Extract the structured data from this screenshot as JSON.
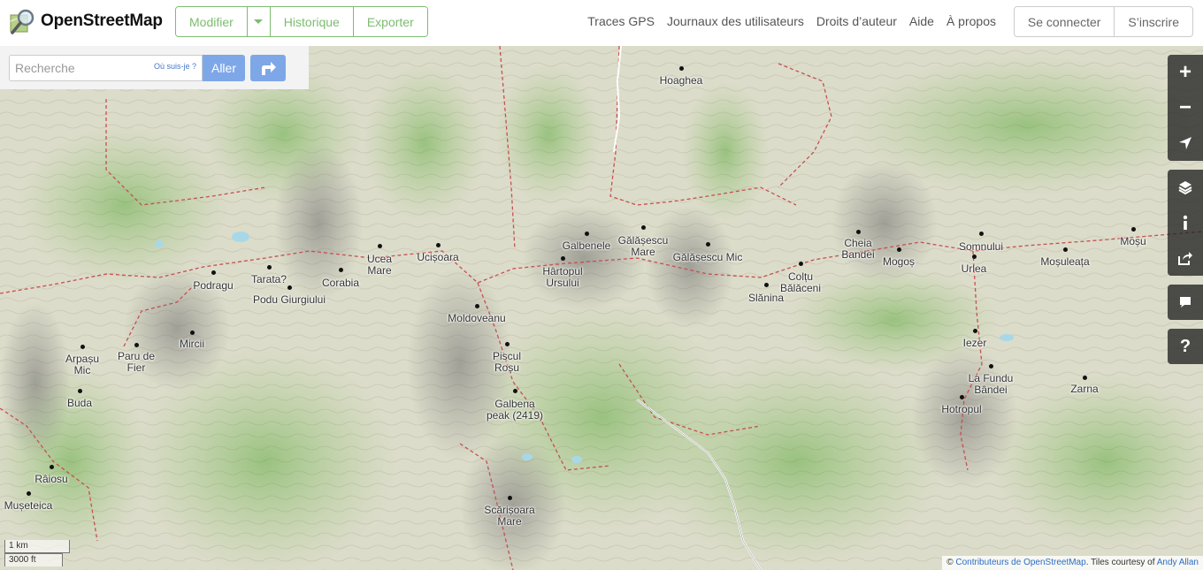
{
  "header": {
    "logo_text": "OpenStreetMap",
    "edit_buttons": [
      "Modifier",
      "Historique",
      "Exporter"
    ],
    "nav_links": [
      "Traces GPS",
      "Journaux des utilisateurs",
      "Droits d’auteur",
      "Aide",
      "À propos"
    ],
    "login_label": "Se connecter",
    "signup_label": "S’inscrire"
  },
  "search": {
    "placeholder": "Recherche",
    "where_am_i": "Où suis-je ?",
    "go_label": "Aller"
  },
  "controls": {
    "zoom_in": "+",
    "zoom_out": "−",
    "help": "?"
  },
  "scale": {
    "metric": "1 km",
    "imperial": "3000 ft"
  },
  "attribution": {
    "prefix": "© ",
    "osm_link": "Contributeurs de OpenStreetMap",
    "middle": ". Tiles courtesy of ",
    "tiles_link": "Andy Allan"
  },
  "places": [
    {
      "name": "Hoaghea"
    },
    {
      "name": "Galbenele"
    },
    {
      "name": "Gălășescu Mare"
    },
    {
      "name": "Gălășescu Mic"
    },
    {
      "name": "Hârtopul Ursului"
    },
    {
      "name": "Ucea Mare"
    },
    {
      "name": "Ucișoara"
    },
    {
      "name": "Corabia"
    },
    {
      "name": "Podragu"
    },
    {
      "name": "Tarata?"
    },
    {
      "name": "Podu Giurgiului"
    },
    {
      "name": "Moldoveanu"
    },
    {
      "name": "Mircii"
    },
    {
      "name": "Paru de Fier"
    },
    {
      "name": "Arpașu Mic"
    },
    {
      "name": "Buda"
    },
    {
      "name": "Piscul Roșu"
    },
    {
      "name": "Galbena peak (2419)"
    },
    {
      "name": "Scărișoara Mare"
    },
    {
      "name": "Râiosu"
    },
    {
      "name": "Mușeteica"
    },
    {
      "name": "Slănina"
    },
    {
      "name": "Colțu Bălăceni"
    },
    {
      "name": "Cheia Bandei"
    },
    {
      "name": "Mogoș"
    },
    {
      "name": "Somnului"
    },
    {
      "name": "Urlea"
    },
    {
      "name": "Moșuleața"
    },
    {
      "name": "Moșu"
    },
    {
      "name": "Iezer"
    },
    {
      "name": "La Fundu Bândei"
    },
    {
      "name": "Hotropul"
    },
    {
      "name": "Zarna"
    }
  ]
}
